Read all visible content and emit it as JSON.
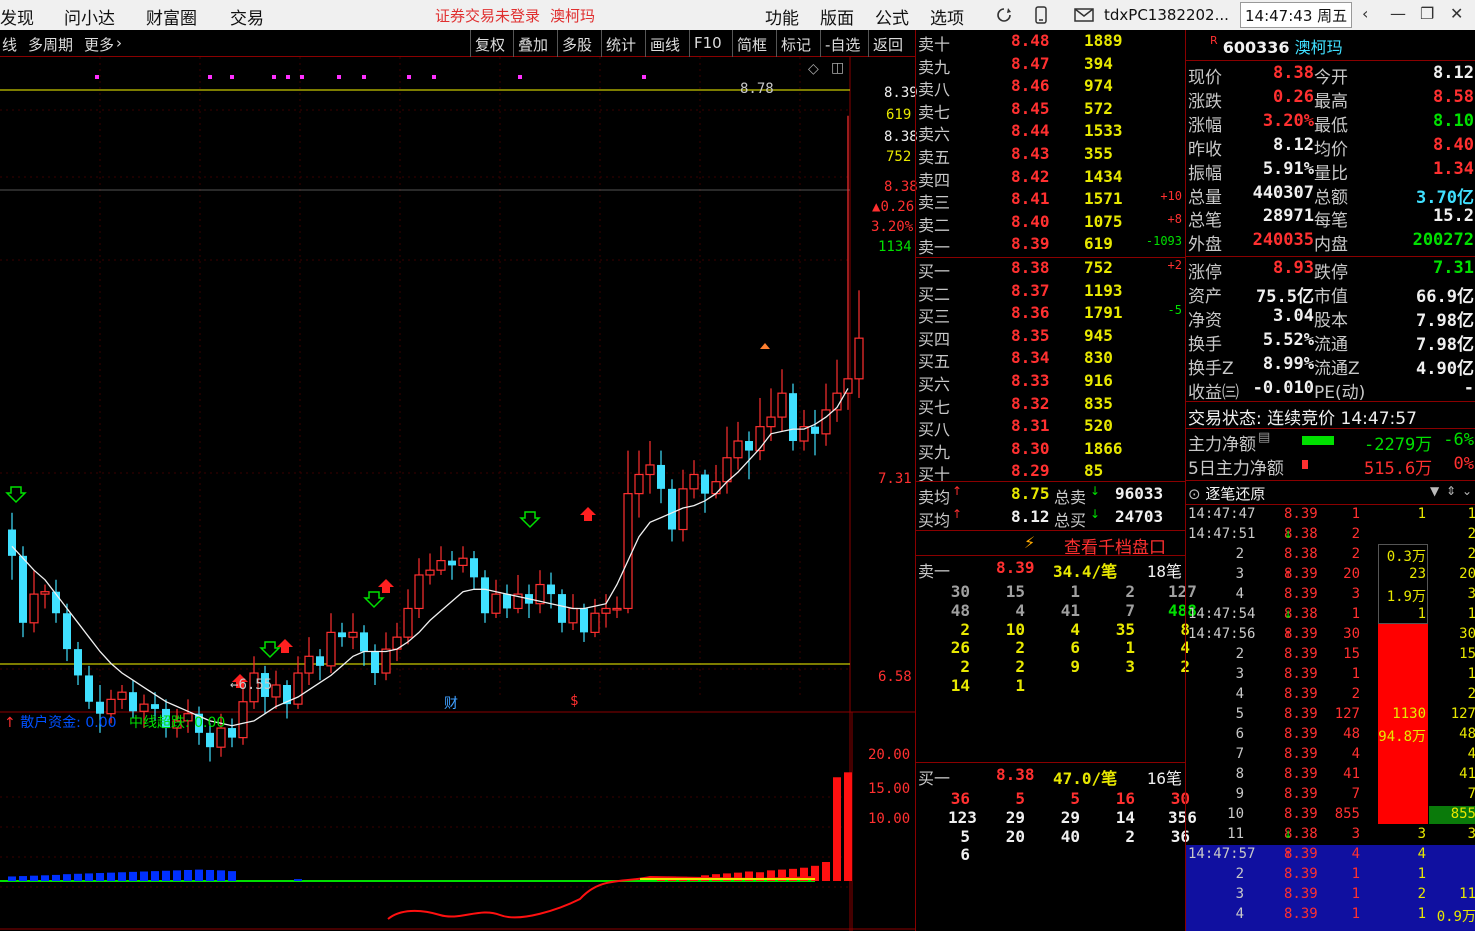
{
  "menubar": {
    "items": [
      "发现",
      "问小达",
      "财富圈",
      "交易"
    ],
    "warning": "证券交易未登录",
    "stock_name": "澳柯玛",
    "right_items": [
      "功能",
      "版面",
      "公式",
      "选项"
    ],
    "user": "tdxPC1382202...",
    "clock": "14:47:43 周五"
  },
  "toolbar": {
    "left": [
      "线",
      "多周期",
      "更多"
    ],
    "right": [
      "复权",
      "叠加",
      "多股",
      "统计",
      "画线",
      "F10",
      "简框",
      "标记",
      "-自选",
      "返回"
    ]
  },
  "chart_data": {
    "type": "candlestick",
    "price_axis": {
      "ticks": [
        "8.39",
        "619",
        "8.38",
        "752",
        "8.38",
        "0.26",
        "3.20%",
        "1134",
        "7.31",
        "6.58"
      ]
    },
    "annotations": {
      "high": "8.78",
      "low": "6.55",
      "marker_cai": "财",
      "marker_dollar": "$"
    },
    "y_range": [
      6.4,
      8.9
    ],
    "candles": [
      {
        "o": 7.05,
        "c": 6.94,
        "h": 7.12,
        "l": 6.84
      },
      {
        "o": 6.94,
        "c": 6.66,
        "h": 6.98,
        "l": 6.6
      },
      {
        "o": 6.66,
        "c": 6.78,
        "h": 6.88,
        "l": 6.62
      },
      {
        "o": 6.78,
        "c": 6.79,
        "h": 6.82,
        "l": 6.72
      },
      {
        "o": 6.79,
        "c": 6.7,
        "h": 6.84,
        "l": 6.66
      },
      {
        "o": 6.7,
        "c": 6.55,
        "h": 6.74,
        "l": 6.5
      },
      {
        "o": 6.55,
        "c": 6.44,
        "h": 6.58,
        "l": 6.4
      },
      {
        "o": 6.44,
        "c": 6.33,
        "h": 6.48,
        "l": 6.3
      },
      {
        "o": 6.33,
        "c": 6.28,
        "h": 6.4,
        "l": 6.2
      },
      {
        "o": 6.28,
        "c": 6.34,
        "h": 6.38,
        "l": 6.24
      },
      {
        "o": 6.34,
        "c": 6.37,
        "h": 6.4,
        "l": 6.3
      },
      {
        "o": 6.37,
        "c": 6.29,
        "h": 6.42,
        "l": 6.26
      },
      {
        "o": 6.29,
        "c": 6.32,
        "h": 6.36,
        "l": 6.22
      },
      {
        "o": 6.32,
        "c": 6.3,
        "h": 6.37,
        "l": 6.25
      },
      {
        "o": 6.3,
        "c": 6.22,
        "h": 6.34,
        "l": 6.18
      },
      {
        "o": 6.22,
        "c": 6.25,
        "h": 6.3,
        "l": 6.18
      },
      {
        "o": 6.25,
        "c": 6.28,
        "h": 6.34,
        "l": 6.2
      },
      {
        "o": 6.28,
        "c": 6.2,
        "h": 6.31,
        "l": 6.15
      },
      {
        "o": 6.2,
        "c": 6.14,
        "h": 6.24,
        "l": 6.08
      },
      {
        "o": 6.14,
        "c": 6.22,
        "h": 6.28,
        "l": 6.1
      },
      {
        "o": 6.22,
        "c": 6.18,
        "h": 6.26,
        "l": 6.14
      },
      {
        "o": 6.18,
        "c": 6.33,
        "h": 6.4,
        "l": 6.15
      },
      {
        "o": 6.33,
        "c": 6.45,
        "h": 6.52,
        "l": 6.3
      },
      {
        "o": 6.45,
        "c": 6.35,
        "h": 6.48,
        "l": 6.28
      },
      {
        "o": 6.35,
        "c": 6.4,
        "h": 6.46,
        "l": 6.3
      },
      {
        "o": 6.4,
        "c": 6.32,
        "h": 6.42,
        "l": 6.26
      },
      {
        "o": 6.32,
        "c": 6.45,
        "h": 6.52,
        "l": 6.3
      },
      {
        "o": 6.45,
        "c": 6.52,
        "h": 6.6,
        "l": 6.4
      },
      {
        "o": 6.52,
        "c": 6.48,
        "h": 6.55,
        "l": 6.42
      },
      {
        "o": 6.48,
        "c": 6.62,
        "h": 6.7,
        "l": 6.45
      },
      {
        "o": 6.62,
        "c": 6.6,
        "h": 6.66,
        "l": 6.56
      },
      {
        "o": 6.6,
        "c": 6.62,
        "h": 6.7,
        "l": 6.55
      },
      {
        "o": 6.62,
        "c": 6.54,
        "h": 6.65,
        "l": 6.48
      },
      {
        "o": 6.54,
        "c": 6.45,
        "h": 6.57,
        "l": 6.4
      },
      {
        "o": 6.45,
        "c": 6.55,
        "h": 6.62,
        "l": 6.42
      },
      {
        "o": 6.55,
        "c": 6.6,
        "h": 6.66,
        "l": 6.5
      },
      {
        "o": 6.6,
        "c": 6.72,
        "h": 6.8,
        "l": 6.57
      },
      {
        "o": 6.72,
        "c": 6.86,
        "h": 6.93,
        "l": 6.68
      },
      {
        "o": 6.86,
        "c": 6.88,
        "h": 6.95,
        "l": 6.82
      },
      {
        "o": 6.88,
        "c": 6.92,
        "h": 6.98,
        "l": 6.86
      },
      {
        "o": 6.92,
        "c": 6.9,
        "h": 6.96,
        "l": 6.84
      },
      {
        "o": 6.9,
        "c": 6.93,
        "h": 6.98,
        "l": 6.87
      },
      {
        "o": 6.93,
        "c": 6.85,
        "h": 6.96,
        "l": 6.8
      },
      {
        "o": 6.85,
        "c": 6.7,
        "h": 6.88,
        "l": 6.66
      },
      {
        "o": 6.7,
        "c": 6.78,
        "h": 6.84,
        "l": 6.68
      },
      {
        "o": 6.78,
        "c": 6.72,
        "h": 6.82,
        "l": 6.68
      },
      {
        "o": 6.72,
        "c": 6.78,
        "h": 6.86,
        "l": 6.7
      },
      {
        "o": 6.78,
        "c": 6.74,
        "h": 6.82,
        "l": 6.68
      },
      {
        "o": 6.74,
        "c": 6.82,
        "h": 6.88,
        "l": 6.7
      },
      {
        "o": 6.82,
        "c": 6.78,
        "h": 6.87,
        "l": 6.72
      },
      {
        "o": 6.78,
        "c": 6.66,
        "h": 6.8,
        "l": 6.62
      },
      {
        "o": 6.66,
        "c": 6.72,
        "h": 6.78,
        "l": 6.63
      },
      {
        "o": 6.72,
        "c": 6.62,
        "h": 6.74,
        "l": 6.58
      },
      {
        "o": 6.62,
        "c": 6.7,
        "h": 6.76,
        "l": 6.6
      },
      {
        "o": 6.7,
        "c": 6.72,
        "h": 6.78,
        "l": 6.64
      },
      {
        "o": 6.72,
        "c": 6.72,
        "h": 6.77,
        "l": 6.68
      },
      {
        "o": 6.72,
        "c": 7.2,
        "h": 7.38,
        "l": 6.7
      },
      {
        "o": 7.2,
        "c": 7.28,
        "h": 7.38,
        "l": 7.1
      },
      {
        "o": 7.28,
        "c": 7.32,
        "h": 7.42,
        "l": 7.2
      },
      {
        "o": 7.32,
        "c": 7.22,
        "h": 7.38,
        "l": 7.16
      },
      {
        "o": 7.22,
        "c": 7.05,
        "h": 7.26,
        "l": 7.0
      },
      {
        "o": 7.05,
        "c": 7.22,
        "h": 7.3,
        "l": 7.0
      },
      {
        "o": 7.22,
        "c": 7.28,
        "h": 7.34,
        "l": 7.18
      },
      {
        "o": 7.28,
        "c": 7.2,
        "h": 7.3,
        "l": 7.12
      },
      {
        "o": 7.2,
        "c": 7.25,
        "h": 7.32,
        "l": 7.18
      },
      {
        "o": 7.25,
        "c": 7.35,
        "h": 7.48,
        "l": 7.2
      },
      {
        "o": 7.35,
        "c": 7.42,
        "h": 7.5,
        "l": 7.3
      },
      {
        "o": 7.42,
        "c": 7.38,
        "h": 7.46,
        "l": 7.26
      },
      {
        "o": 7.38,
        "c": 7.48,
        "h": 7.6,
        "l": 7.34
      },
      {
        "o": 7.48,
        "c": 7.52,
        "h": 7.64,
        "l": 7.42
      },
      {
        "o": 7.52,
        "c": 7.62,
        "h": 7.72,
        "l": 7.46
      },
      {
        "o": 7.62,
        "c": 7.42,
        "h": 7.66,
        "l": 7.38
      },
      {
        "o": 7.42,
        "c": 7.48,
        "h": 7.55,
        "l": 7.38
      },
      {
        "o": 7.48,
        "c": 7.45,
        "h": 7.55,
        "l": 7.36
      },
      {
        "o": 7.45,
        "c": 7.55,
        "h": 7.66,
        "l": 7.4
      },
      {
        "o": 7.55,
        "c": 7.62,
        "h": 7.76,
        "l": 7.5
      },
      {
        "o": 7.62,
        "c": 7.68,
        "h": 8.78,
        "l": 7.55
      },
      {
        "o": 7.68,
        "c": 7.85,
        "h": 8.05,
        "l": 7.6
      }
    ],
    "ma": [
      6.98,
      6.93,
      6.88,
      6.84,
      6.78,
      6.72,
      6.66,
      6.6,
      6.54,
      6.49,
      6.45,
      6.42,
      6.39,
      6.36,
      6.33,
      6.31,
      6.29,
      6.27,
      6.25,
      6.24,
      6.23,
      6.24,
      6.25,
      6.28,
      6.31,
      6.33,
      6.35,
      6.38,
      6.41,
      6.44,
      6.48,
      6.52,
      6.54,
      6.54,
      6.54,
      6.55,
      6.58,
      6.62,
      6.67,
      6.71,
      6.75,
      6.79,
      6.8,
      6.8,
      6.79,
      6.78,
      6.77,
      6.76,
      6.75,
      6.74,
      6.73,
      6.72,
      6.72,
      6.73,
      6.74,
      6.82,
      6.92,
      7.02,
      7.08,
      7.1,
      7.12,
      7.14,
      7.15,
      7.17,
      7.2,
      7.25,
      7.29,
      7.34,
      7.39,
      7.45,
      7.46,
      7.47,
      7.47,
      7.49,
      7.52,
      7.56,
      7.64
    ],
    "indicator": {
      "label1": "散户资金: 0.00",
      "label2": "中线超跌: 0.00",
      "ticks": [
        "20.00",
        "15.00",
        "10.00"
      ],
      "blue_bars": [
        1.2,
        1.3,
        1.4,
        1.5,
        1.6,
        1.8,
        1.9,
        2.0,
        2.1,
        2.2,
        2.3,
        2.4,
        2.5,
        2.6,
        2.7,
        2.8,
        2.9,
        3.0,
        2.9,
        2.8,
        2.6,
        0,
        0,
        0,
        0,
        0,
        0.5,
        0,
        0,
        0,
        0,
        0
      ],
      "red_bars": [
        0,
        0,
        0,
        0,
        0,
        0,
        0,
        0,
        0,
        0,
        0,
        0,
        0,
        0,
        0,
        0,
        0,
        0,
        0,
        0,
        0,
        0,
        0,
        0,
        0,
        0,
        0,
        0,
        0,
        0,
        0,
        0,
        0,
        0,
        0,
        0,
        0,
        0,
        0,
        0,
        0,
        0,
        0,
        0,
        0,
        0,
        0,
        0,
        0,
        0,
        0,
        0,
        0,
        0,
        0,
        0,
        0,
        0,
        0,
        1.0,
        1.2,
        1.1,
        1.0,
        1.5,
        1.8,
        2.0,
        2.2,
        2.5,
        2.3,
        2.8,
        3.0,
        3.2,
        3.5,
        4.0,
        5.0,
        21.0,
        22.0
      ]
    }
  },
  "orderbook": {
    "sells": [
      {
        "label": "卖十",
        "price": "8.48",
        "vol": "1889",
        "chg": ""
      },
      {
        "label": "卖九",
        "price": "8.47",
        "vol": "394",
        "chg": ""
      },
      {
        "label": "卖八",
        "price": "8.46",
        "vol": "974",
        "chg": ""
      },
      {
        "label": "卖七",
        "price": "8.45",
        "vol": "572",
        "chg": ""
      },
      {
        "label": "卖六",
        "price": "8.44",
        "vol": "1533",
        "chg": ""
      },
      {
        "label": "卖五",
        "price": "8.43",
        "vol": "355",
        "chg": ""
      },
      {
        "label": "卖四",
        "price": "8.42",
        "vol": "1434",
        "chg": ""
      },
      {
        "label": "卖三",
        "price": "8.41",
        "vol": "1571",
        "chg": "+10"
      },
      {
        "label": "卖二",
        "price": "8.40",
        "vol": "1075",
        "chg": "+8"
      },
      {
        "label": "卖一",
        "price": "8.39",
        "vol": "619",
        "chg": "-1093"
      }
    ],
    "buys": [
      {
        "label": "买一",
        "price": "8.38",
        "vol": "752",
        "chg": "+2"
      },
      {
        "label": "买二",
        "price": "8.37",
        "vol": "1193",
        "chg": ""
      },
      {
        "label": "买三",
        "price": "8.36",
        "vol": "1791",
        "chg": "-5"
      },
      {
        "label": "买四",
        "price": "8.35",
        "vol": "945",
        "chg": ""
      },
      {
        "label": "买五",
        "price": "8.34",
        "vol": "830",
        "chg": ""
      },
      {
        "label": "买六",
        "price": "8.33",
        "vol": "916",
        "chg": ""
      },
      {
        "label": "买七",
        "price": "8.32",
        "vol": "835",
        "chg": ""
      },
      {
        "label": "买八",
        "price": "8.31",
        "vol": "520",
        "chg": ""
      },
      {
        "label": "买九",
        "price": "8.30",
        "vol": "1866",
        "chg": ""
      },
      {
        "label": "买十",
        "price": "8.29",
        "vol": "85",
        "chg": ""
      }
    ],
    "avg_sell": {
      "label": "卖均",
      "price": "8.75",
      "total_label": "总卖",
      "total": "96033"
    },
    "avg_buy": {
      "label": "买均",
      "price": "8.12",
      "total_label": "总买",
      "total": "24703"
    },
    "view_more": "查看千档盘口",
    "sell1_detail": {
      "label": "卖一",
      "price": "8.39",
      "avg": "34.4/笔",
      "count": "18笔",
      "rows": [
        [
          "30",
          "15",
          "1",
          "2",
          "127"
        ],
        [
          "48",
          "4",
          "41",
          "7",
          "488"
        ],
        [
          "2",
          "10",
          "4",
          "35",
          "8"
        ],
        [
          "26",
          "2",
          "6",
          "1",
          "4"
        ],
        [
          "2",
          "2",
          "9",
          "3",
          "2"
        ],
        [
          "14",
          "1",
          "",
          "",
          ""
        ]
      ]
    },
    "buy1_detail": {
      "label": "买一",
      "price": "8.38",
      "avg": "47.0/笔",
      "count": "16笔",
      "rows": [
        [
          "36",
          "5",
          "5",
          "16",
          "30"
        ],
        [
          "123",
          "29",
          "29",
          "14",
          "356"
        ],
        [
          "5",
          "20",
          "40",
          "2",
          "36"
        ],
        [
          "6",
          "",
          "",
          "",
          ""
        ]
      ]
    }
  },
  "info": {
    "code": "600336",
    "name": "澳柯玛",
    "rows": [
      {
        "l1": "现价",
        "v1": "8.38",
        "l2": "今开",
        "v2": "8.12"
      },
      {
        "l1": "涨跌",
        "v1": "0.26",
        "l2": "最高",
        "v2": "8.58"
      },
      {
        "l1": "涨幅",
        "v1": "3.20%",
        "l2": "最低",
        "v2": "8.10"
      },
      {
        "l1": "昨收",
        "v1": "8.12",
        "l2": "均价",
        "v2": "8.40"
      },
      {
        "l1": "振幅",
        "v1": "5.91%",
        "l2": "量比",
        "v2": "1.34"
      },
      {
        "l1": "总量",
        "v1": "440307",
        "l2": "总额",
        "v2": "3.70亿"
      },
      {
        "l1": "总笔",
        "v1": "28971",
        "l2": "每笔",
        "v2": "15.2"
      },
      {
        "l1": "外盘",
        "v1": "240035",
        "l2": "内盘",
        "v2": "200272"
      },
      {
        "l1": "涨停",
        "v1": "8.93",
        "l2": "跌停",
        "v2": "7.31"
      },
      {
        "l1": "资产",
        "v1": "75.5亿",
        "l2": "市值",
        "v2": "66.9亿"
      },
      {
        "l1": "净资",
        "v1": "3.04",
        "l2": "股本",
        "v2": "7.98亿"
      },
      {
        "l1": "换手",
        "v1": "5.52%",
        "l2": "流通",
        "v2": "7.98亿"
      },
      {
        "l1": "换手Z",
        "v1": "8.99%",
        "l2": "流通Z",
        "v2": "4.90亿"
      },
      {
        "l1": "收益㈢",
        "v1": "-0.010",
        "l2": "PE(动)",
        "v2": "-"
      }
    ],
    "trade_status": "交易状态: 连续竞价 14:47:57",
    "main_flow": {
      "label": "主力净额",
      "value": "-2279万",
      "pct": "-6%"
    },
    "flow5": {
      "label": "5日主力净额",
      "value": "515.6万",
      "pct": "0%"
    },
    "ticks_title": "逐笔还原",
    "ticks": [
      {
        "t": "14:47:47",
        "p": "8.39",
        "v": "1",
        "a": "1",
        "r": "1",
        "d": ""
      },
      {
        "t": "14:47:51",
        "p": "8.38",
        "v": "2",
        "a": "",
        "r": "2",
        "d": "dn"
      },
      {
        "t": "2",
        "p": "8.38",
        "v": "2",
        "a": "0.3万",
        "r": "2",
        "d": ""
      },
      {
        "t": "3",
        "p": "8.39",
        "v": "20",
        "a": "23",
        "r": "20",
        "d": "up"
      },
      {
        "t": "4",
        "p": "8.39",
        "v": "3",
        "a": "1.9万",
        "r": "3",
        "d": ""
      },
      {
        "t": "14:47:54",
        "p": "8.38",
        "v": "1",
        "a": "1",
        "r": "1",
        "d": "dn"
      },
      {
        "t": "14:47:56",
        "p": "8.39",
        "v": "30",
        "a": "",
        "r": "30",
        "d": "up"
      },
      {
        "t": "2",
        "p": "8.39",
        "v": "15",
        "a": "",
        "r": "15",
        "d": ""
      },
      {
        "t": "3",
        "p": "8.39",
        "v": "1",
        "a": "",
        "r": "1",
        "d": ""
      },
      {
        "t": "4",
        "p": "8.39",
        "v": "2",
        "a": "",
        "r": "2",
        "d": ""
      },
      {
        "t": "5",
        "p": "8.39",
        "v": "127",
        "a": "1130",
        "r": "127",
        "d": ""
      },
      {
        "t": "6",
        "p": "8.39",
        "v": "48",
        "a": "94.8万",
        "r": "48",
        "d": ""
      },
      {
        "t": "7",
        "p": "8.39",
        "v": "4",
        "a": "",
        "r": "4",
        "d": ""
      },
      {
        "t": "8",
        "p": "8.39",
        "v": "41",
        "a": "",
        "r": "41",
        "d": ""
      },
      {
        "t": "9",
        "p": "8.39",
        "v": "7",
        "a": "",
        "r": "7",
        "d": ""
      },
      {
        "t": "10",
        "p": "8.39",
        "v": "855",
        "a": "",
        "r": "855",
        "d": ""
      },
      {
        "t": "11",
        "p": "8.38",
        "v": "3",
        "a": "3",
        "r": "3",
        "d": "dn"
      },
      {
        "t": "14:47:57",
        "p": "8.39",
        "v": "4",
        "a": "4",
        "r": "",
        "d": "up"
      },
      {
        "t": "2",
        "p": "8.39",
        "v": "1",
        "a": "1",
        "r": "",
        "d": ""
      },
      {
        "t": "3",
        "p": "8.39",
        "v": "1",
        "a": "2",
        "r": "11",
        "d": ""
      },
      {
        "t": "4",
        "p": "8.39",
        "v": "1",
        "a": "1",
        "r": "0.9万",
        "d": ""
      }
    ]
  },
  "colors": {
    "up": "#ff3030",
    "down": "#40e0ff",
    "yellow": "#e8e800",
    "green": "#00e000",
    "blue_bar": "#0030ff",
    "menu_bg": "#f0f0f0",
    "sep": "#8a0000"
  }
}
